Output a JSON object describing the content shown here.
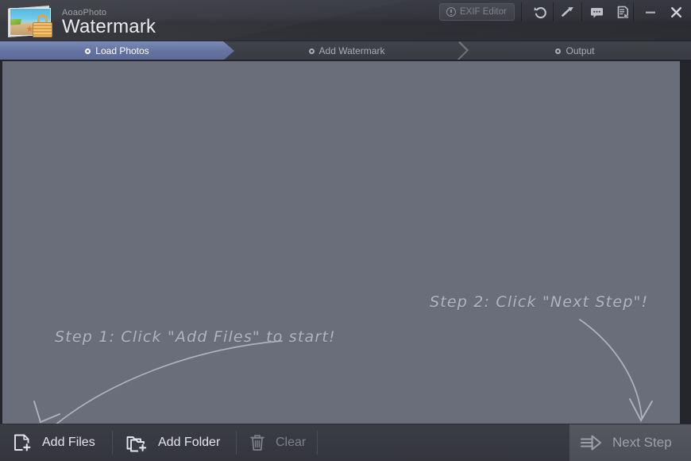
{
  "window": {
    "vendor": "AoaoPhoto",
    "title": "Watermark",
    "logo_icon": "photo-lock-icon"
  },
  "titlebar": {
    "exif_button": {
      "label": "EXIF Editor",
      "icon": "exclamation-circle-icon",
      "enabled": false
    },
    "tools": [
      {
        "name": "undo-button",
        "icon": "undo-arrow-icon"
      },
      {
        "name": "settings-button",
        "icon": "wrench-icon"
      },
      {
        "name": "feedback-button",
        "icon": "speech-bubble-icon"
      },
      {
        "name": "register-button",
        "icon": "document-check-icon"
      }
    ],
    "minimize": {
      "label": "–",
      "icon": "minimize-icon"
    },
    "close": {
      "label": "✕",
      "icon": "close-icon"
    }
  },
  "steps": [
    {
      "label": "Load Photos",
      "active": true,
      "icon": "step-dot-icon"
    },
    {
      "label": "Add Watermark",
      "active": false,
      "icon": "step-dot-icon"
    },
    {
      "label": "Output",
      "active": false,
      "icon": "step-dot-icon"
    }
  ],
  "canvas": {
    "hints": [
      {
        "text": "Step 1: Click \"Add Files\" to start!"
      },
      {
        "text": "Step 2: Click \"Next Step\"!"
      }
    ],
    "background_color": "#6a6e7a"
  },
  "bottombar": {
    "add_files": {
      "label": "Add Files",
      "icon": "file-plus-icon",
      "enabled": true
    },
    "add_folder": {
      "label": "Add Folder",
      "icon": "folder-plus-icon",
      "enabled": true
    },
    "clear": {
      "label": "Clear",
      "icon": "trash-icon",
      "enabled": false
    },
    "next_step": {
      "label": "Next Step",
      "icon": "arrow-right-icon",
      "enabled": true
    }
  },
  "colors": {
    "accent_step": "#64739f",
    "canvas": "#6a6e7a",
    "chrome_dark": "#35373d",
    "hint_text": "#b9bcc5",
    "logo_lock": "#e0a040"
  }
}
